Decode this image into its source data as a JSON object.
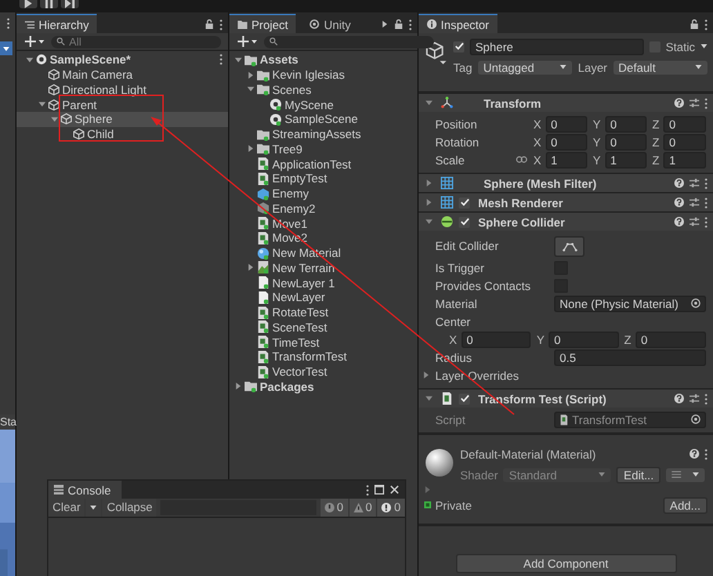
{
  "scene_view": {
    "tab": "Sta"
  },
  "hierarchy": {
    "title": "Hierarchy",
    "search": {
      "placeholder": "All"
    },
    "tree": [
      {
        "label": "SampleScene*",
        "kind": "scene",
        "selected": false,
        "expanded": true,
        "children": [
          {
            "label": "Main Camera",
            "kind": "object",
            "selected": false
          },
          {
            "label": "Directional Light",
            "kind": "object",
            "selected": false
          },
          {
            "label": "Parent",
            "kind": "object",
            "selected": false,
            "expanded": true,
            "children": [
              {
                "label": "Sphere",
                "kind": "object",
                "selected": true,
                "expanded": true,
                "children": [
                  {
                    "label": "Child",
                    "kind": "object",
                    "selected": false
                  }
                ]
              }
            ]
          }
        ]
      }
    ]
  },
  "project": {
    "tabs": [
      {
        "label": "Project",
        "selected": true
      },
      {
        "label": "Unity",
        "selected": false
      }
    ],
    "tree": [
      {
        "label": "Assets",
        "kind": "folder",
        "selected": false,
        "expanded": true,
        "children": [
          {
            "label": "Kevin Iglesias",
            "kind": "folder",
            "selected": false,
            "expanded": false
          },
          {
            "label": "Scenes",
            "kind": "folder",
            "selected": false,
            "expanded": true,
            "children": [
              {
                "label": "MyScene",
                "kind": "scene",
                "selected": false
              },
              {
                "label": "SampleScene",
                "kind": "scene",
                "selected": false
              }
            ]
          },
          {
            "label": "StreamingAssets",
            "kind": "folder",
            "selected": false
          },
          {
            "label": "Tree9",
            "kind": "folder",
            "selected": false,
            "expanded": false
          },
          {
            "label": "ApplicationTest",
            "kind": "script",
            "selected": false
          },
          {
            "label": "EmptyTest",
            "kind": "script",
            "selected": false
          },
          {
            "label": "Enemy",
            "kind": "prefab",
            "selected": false
          },
          {
            "label": "Enemy2",
            "kind": "model",
            "selected": false
          },
          {
            "label": "Move1",
            "kind": "script",
            "selected": false
          },
          {
            "label": "Move2",
            "kind": "script",
            "selected": false
          },
          {
            "label": "New Material",
            "kind": "material",
            "selected": false
          },
          {
            "label": "New Terrain",
            "kind": "terrain",
            "selected": false,
            "expanded": false
          },
          {
            "label": "NewLayer 1",
            "kind": "file",
            "selected": false
          },
          {
            "label": "NewLayer",
            "kind": "file",
            "selected": false
          },
          {
            "label": "RotateTest",
            "kind": "script",
            "selected": false
          },
          {
            "label": "SceneTest",
            "kind": "script",
            "selected": false
          },
          {
            "label": "TimeTest",
            "kind": "script",
            "selected": false
          },
          {
            "label": "TransformTest",
            "kind": "script",
            "selected": false
          },
          {
            "label": "VectorTest",
            "kind": "script",
            "selected": false
          }
        ]
      },
      {
        "label": "Packages",
        "kind": "folder",
        "selected": false,
        "expanded": false
      }
    ]
  },
  "inspector": {
    "title": "Inspector",
    "object": {
      "name": "Sphere",
      "active": true,
      "static_label": "Static",
      "static": false,
      "tag_label": "Tag",
      "tag": "Untagged",
      "layer_label": "Layer",
      "layer": "Default"
    },
    "components": [
      {
        "kind": "transform",
        "title": "Transform",
        "expanded": true,
        "fields": [
          {
            "kind": "vector",
            "label": "Position",
            "values": [
              {
                "axis": "X",
                "value": "0"
              },
              {
                "axis": "Y",
                "value": "0"
              },
              {
                "axis": "Z",
                "value": "0"
              }
            ]
          },
          {
            "kind": "vector",
            "label": "Rotation",
            "values": [
              {
                "axis": "X",
                "value": "0"
              },
              {
                "axis": "Y",
                "value": "0"
              },
              {
                "axis": "Z",
                "value": "0"
              }
            ]
          },
          {
            "kind": "vector",
            "label": "Scale",
            "linked": false,
            "values": [
              {
                "axis": "X",
                "value": "1"
              },
              {
                "axis": "Y",
                "value": "1"
              },
              {
                "axis": "Z",
                "value": "1"
              }
            ]
          }
        ]
      },
      {
        "kind": "mesh_filter",
        "title": "Sphere (Mesh Filter)",
        "expanded": false
      },
      {
        "kind": "mesh_renderer",
        "title": "Mesh Renderer",
        "expanded": false,
        "enabled": true
      },
      {
        "kind": "sphere_collider",
        "title": "Sphere Collider",
        "expanded": true,
        "enabled": true,
        "fields": [
          {
            "kind": "button",
            "label": "Edit Collider"
          },
          {
            "kind": "checkbox",
            "label": "Is Trigger",
            "checked": false
          },
          {
            "kind": "checkbox",
            "label": "Provides Contacts",
            "checked": false
          },
          {
            "kind": "object",
            "label": "Material",
            "value": "None (Physic Material)"
          },
          {
            "kind": "heading",
            "label": "Center"
          },
          {
            "kind": "xyz",
            "values": [
              {
                "axis": "X",
                "value": "0"
              },
              {
                "axis": "Y",
                "value": "0"
              },
              {
                "axis": "Z",
                "value": "0"
              }
            ]
          },
          {
            "kind": "text",
            "label": "Radius",
            "value": "0.5"
          },
          {
            "kind": "foldout",
            "label": "Layer Overrides",
            "expanded": false
          }
        ]
      },
      {
        "kind": "script",
        "title": "Transform Test (Script)",
        "expanded": true,
        "enabled": true,
        "fields": [
          {
            "kind": "object",
            "label": "Script",
            "value": "TransformTest",
            "disabled": true
          }
        ]
      }
    ],
    "material": {
      "title": "Default-Material (Material)",
      "shader_label": "Shader",
      "shader": "Standard",
      "edit": "Edit...",
      "private_label": "Private",
      "add": "Add..."
    },
    "add_component": "Add Component"
  },
  "console": {
    "title": "Console",
    "clear": "Clear",
    "collapse": "Collapse",
    "counts": [
      {
        "kind": "info",
        "value": "0"
      },
      {
        "kind": "warning",
        "value": "0"
      },
      {
        "kind": "error",
        "value": "0"
      }
    ]
  }
}
